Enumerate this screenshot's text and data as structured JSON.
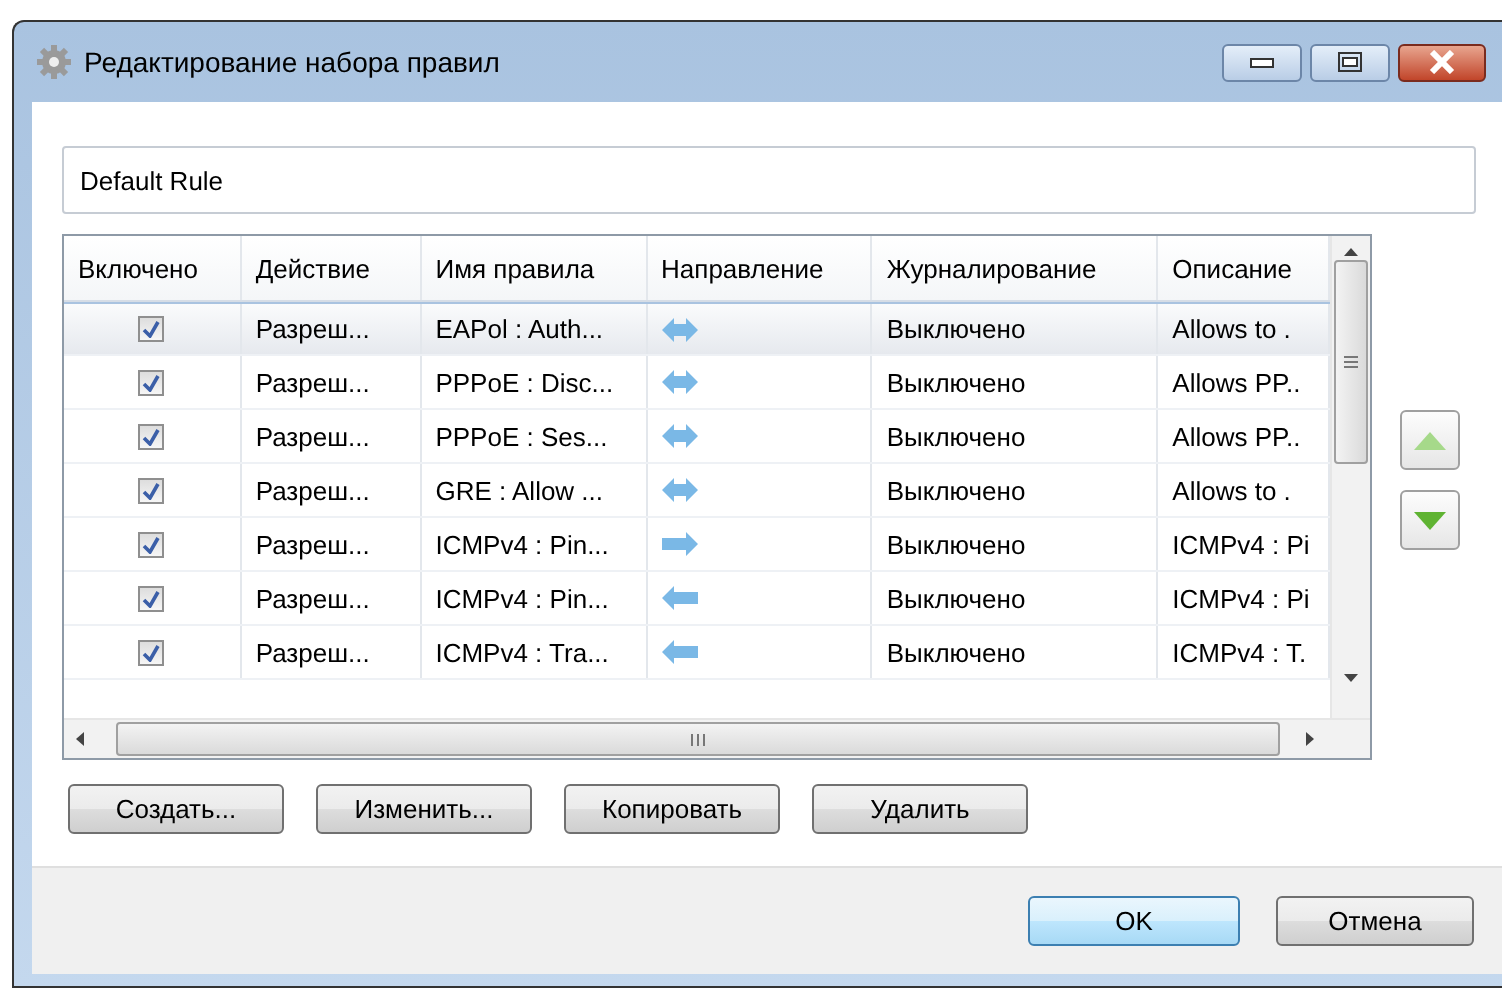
{
  "window": {
    "title": "Редактирование набора правил"
  },
  "name_field": {
    "value": "Default Rule"
  },
  "table": {
    "columns": [
      "Включено",
      "Действие",
      "Имя правила",
      "Направление",
      "Журналирование",
      "Описание"
    ],
    "rows": [
      {
        "enabled": true,
        "selected": true,
        "action": "Разреш...",
        "name": "EAPol : Auth...",
        "kind": "both",
        "logging": "Выключено",
        "description": "Allows to ."
      },
      {
        "enabled": true,
        "selected": false,
        "action": "Разреш...",
        "name": "PPPoE : Disc...",
        "kind": "both",
        "logging": "Выключено",
        "description": "Allows PP.."
      },
      {
        "enabled": true,
        "selected": false,
        "action": "Разреш...",
        "name": "PPPoE : Ses...",
        "kind": "both",
        "logging": "Выключено",
        "description": "Allows PP.."
      },
      {
        "enabled": true,
        "selected": false,
        "action": "Разреш...",
        "name": "GRE : Allow ...",
        "kind": "both",
        "logging": "Выключено",
        "description": "Allows to ."
      },
      {
        "enabled": true,
        "selected": false,
        "action": "Разреш...",
        "name": "ICMPv4 : Pin...",
        "kind": "out",
        "logging": "Выключено",
        "description": "ICMPv4 : Pi"
      },
      {
        "enabled": true,
        "selected": false,
        "action": "Разреш...",
        "name": "ICMPv4 : Pin...",
        "kind": "in",
        "logging": "Выключено",
        "description": "ICMPv4 : Pi"
      },
      {
        "enabled": true,
        "selected": false,
        "action": "Разреш...",
        "name": "ICMPv4 : Tra...",
        "kind": "in",
        "logging": "Выключено",
        "description": "ICMPv4 : T."
      }
    ]
  },
  "rule_buttons": [
    "Создать...",
    "Изменить...",
    "Копировать",
    "Удалить"
  ],
  "dialog_buttons": [
    {
      "label": "OK",
      "default": true
    },
    {
      "label": "Отмена",
      "default": false
    }
  ]
}
